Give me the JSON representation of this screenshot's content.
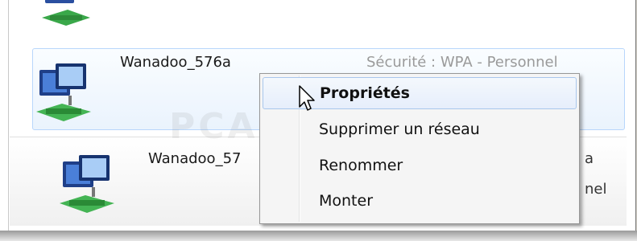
{
  "networks": [
    {
      "name": "Wanadoo_576a",
      "security": "Sécurité : WPA - Personnel",
      "selected": true
    },
    {
      "name": "Wanadoo_57",
      "security_fragment_1": "a",
      "security_fragment_2": "nel",
      "selected": false
    }
  ],
  "context_menu": {
    "items": [
      {
        "label": "Propriétés",
        "bold": true,
        "highlighted": true
      },
      {
        "label": "Supprimer un réseau",
        "bold": false,
        "highlighted": false
      },
      {
        "label": "Renommer",
        "bold": false,
        "highlighted": false
      },
      {
        "label": "Monter",
        "bold": false,
        "highlighted": false
      }
    ]
  },
  "watermark": "PCASTUCES",
  "colors": {
    "selection_border": "#b8d6fb",
    "menu_hover_border": "#a8c6ec",
    "security_text": "#9a9a9a"
  },
  "icons": [
    "network-connection-icon",
    "mouse-cursor-icon"
  ]
}
